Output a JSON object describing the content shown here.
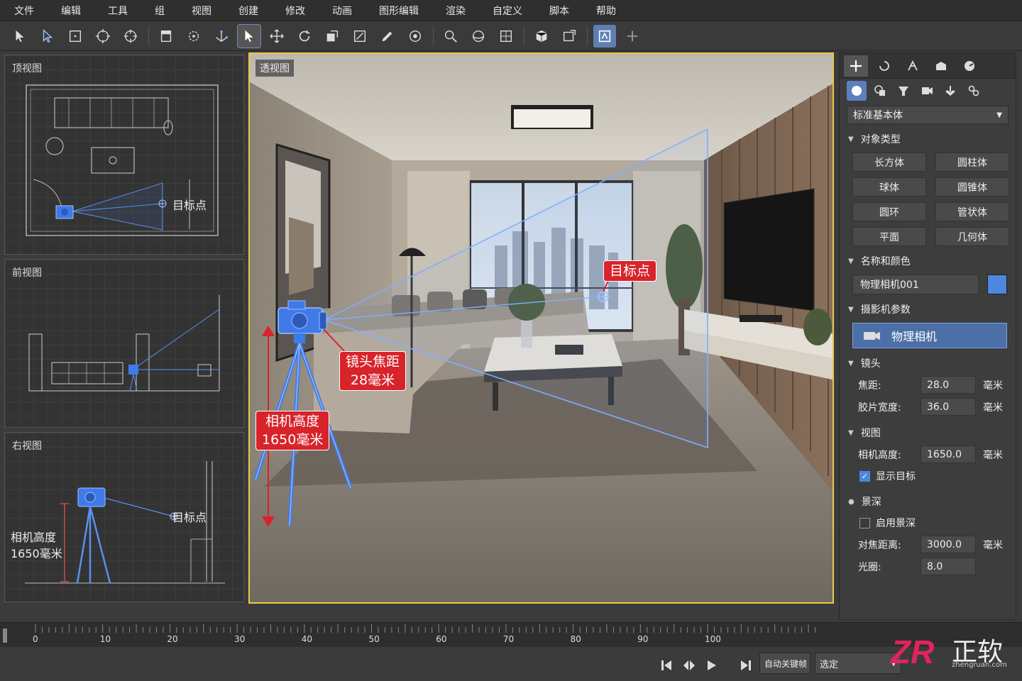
{
  "menu": [
    "文件",
    "编辑",
    "工具",
    "组",
    "视图",
    "创建",
    "修改",
    "动画",
    "图形编辑",
    "渲染",
    "自定义",
    "脚本",
    "帮助"
  ],
  "viewports": {
    "top": {
      "label": "顶视图",
      "target_label": "目标点"
    },
    "front": {
      "label": "前视图"
    },
    "right": {
      "label": "右视图",
      "target_label": "目标点",
      "height_label": "相机高度\n1650毫米",
      "height_line1": "相机高度",
      "height_line2": "1650毫米"
    },
    "perspective": {
      "label": "透视图"
    }
  },
  "callouts": {
    "target": "目标点",
    "focal_line1": "镜头焦距",
    "focal_line2": "28毫米",
    "height_line1": "相机高度",
    "height_line2": "1650毫米"
  },
  "panel": {
    "dropdown": "标准基本体",
    "object_type": {
      "title": "对象类型",
      "buttons": [
        "长方体",
        "圆柱体",
        "球体",
        "圆锥体",
        "圆环",
        "管状体",
        "平面",
        "几何体"
      ]
    },
    "name_color": {
      "title": "名称和颜色",
      "name": "物理相机001",
      "color": "#4f86e0"
    },
    "camera_params": {
      "title": "摄影机参数",
      "camera_button": "物理相机"
    },
    "lens": {
      "title": "镜头",
      "focal_label": "焦距:",
      "focal_value": "28.0",
      "film_label": "胶片宽度:",
      "film_value": "36.0",
      "unit": "毫米"
    },
    "view": {
      "title": "视图",
      "height_label": "相机高度:",
      "height_value": "1650.0",
      "unit": "毫米",
      "show_target": "显示目标",
      "show_target_checked": true
    },
    "dof": {
      "title": "景深",
      "enable_label": "启用景深",
      "enable_checked": false,
      "focus_label": "对焦距离:",
      "focus_value": "3000.0",
      "unit": "毫米",
      "aperture_label": "光圈:",
      "aperture_value": "8.0"
    }
  },
  "timeline": {
    "ticks": [
      "0",
      "10",
      "20",
      "30",
      "40",
      "50",
      "60",
      "70",
      "80",
      "90",
      "100"
    ]
  },
  "bottom": {
    "auto_key": "自动关键帧",
    "selection": "选定"
  },
  "logo": {
    "mark": "ZR",
    "text": "正软",
    "url": "zhengruan.com"
  }
}
